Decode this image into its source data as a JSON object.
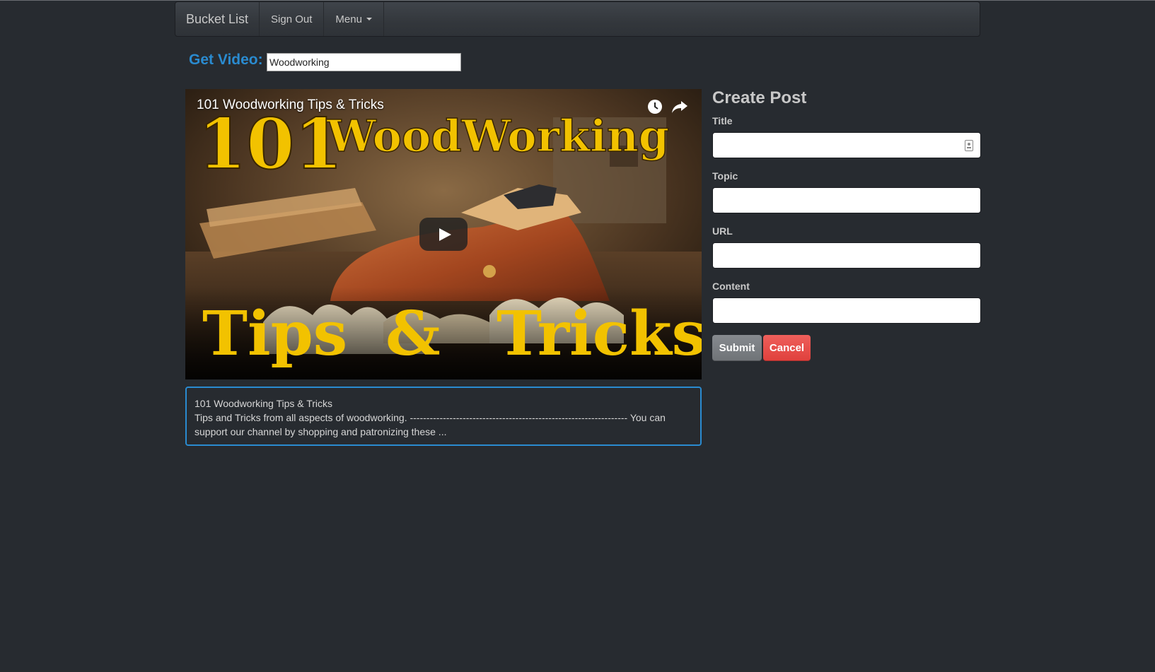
{
  "navbar": {
    "brand": "Bucket List",
    "sign_out": "Sign Out",
    "menu": "Menu"
  },
  "search": {
    "label": "Get Video:",
    "value": "Woodworking"
  },
  "video": {
    "title": "101 Woodworking Tips & Tricks",
    "thumbnail_text_top_number": "101",
    "thumbnail_text_top_word": "WoodWorking",
    "thumbnail_text_bottom_left": "Tips",
    "thumbnail_text_bottom_amp": "&",
    "thumbnail_text_bottom_right": "Tricks",
    "description_title": "101 Woodworking Tips & Tricks",
    "description_body": "Tips and Tricks from all aspects of woodworking. ------------------------------------------------------------------ You can support our channel by shopping and patronizing these ..."
  },
  "create_post": {
    "heading": "Create Post",
    "title_label": "Title",
    "topic_label": "Topic",
    "url_label": "URL",
    "content_label": "Content",
    "submit": "Submit",
    "cancel": "Cancel"
  },
  "colors": {
    "background": "#272b30",
    "accent_blue": "#2a8bd0",
    "danger": "#e0403c",
    "thumbnail_text": "#f2c200"
  },
  "icons": [
    "watch-later-icon",
    "share-icon",
    "play-icon",
    "contact-card-icon",
    "caret-down-icon"
  ]
}
